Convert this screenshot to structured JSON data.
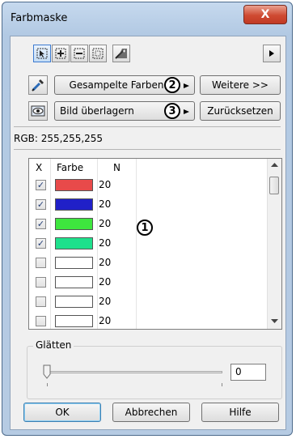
{
  "window": {
    "title": "Farbmaske",
    "close_glyph": "X"
  },
  "toolbar": {
    "tools": [
      "select-tool-icon",
      "add-color-icon",
      "subtract-color-icon",
      "rectangle-select-icon",
      "magic-wand-icon"
    ],
    "more_arrow": "play-arrow-icon"
  },
  "buttons": {
    "sampled_colors": "Gesampelte Farben",
    "more": "Weitere >>",
    "overlay_image": "Bild überlagern",
    "reset": "Zurücksetzen",
    "ok": "OK",
    "cancel": "Abbrechen",
    "help": "Hilfe"
  },
  "callouts": {
    "one": "1",
    "two": "2",
    "three": "3"
  },
  "rgb_readout": "RGB: 255,255,255",
  "table": {
    "columns": {
      "x": "X",
      "color": "Farbe",
      "n": "N"
    },
    "rows": [
      {
        "checked": true,
        "color": "#e84a4a",
        "n": "20"
      },
      {
        "checked": true,
        "color": "#2020c8",
        "n": "20"
      },
      {
        "checked": true,
        "color": "#3ee63e",
        "n": "20"
      },
      {
        "checked": true,
        "color": "#1ee08c",
        "n": "20"
      },
      {
        "checked": false,
        "color": "#ffffff",
        "n": "20"
      },
      {
        "checked": false,
        "color": "#ffffff",
        "n": "20"
      },
      {
        "checked": false,
        "color": "#ffffff",
        "n": "20"
      },
      {
        "checked": false,
        "color": "#ffffff",
        "n": "20"
      }
    ]
  },
  "smoothing": {
    "label": "Glätten",
    "value": "0",
    "slider_level": 0
  }
}
